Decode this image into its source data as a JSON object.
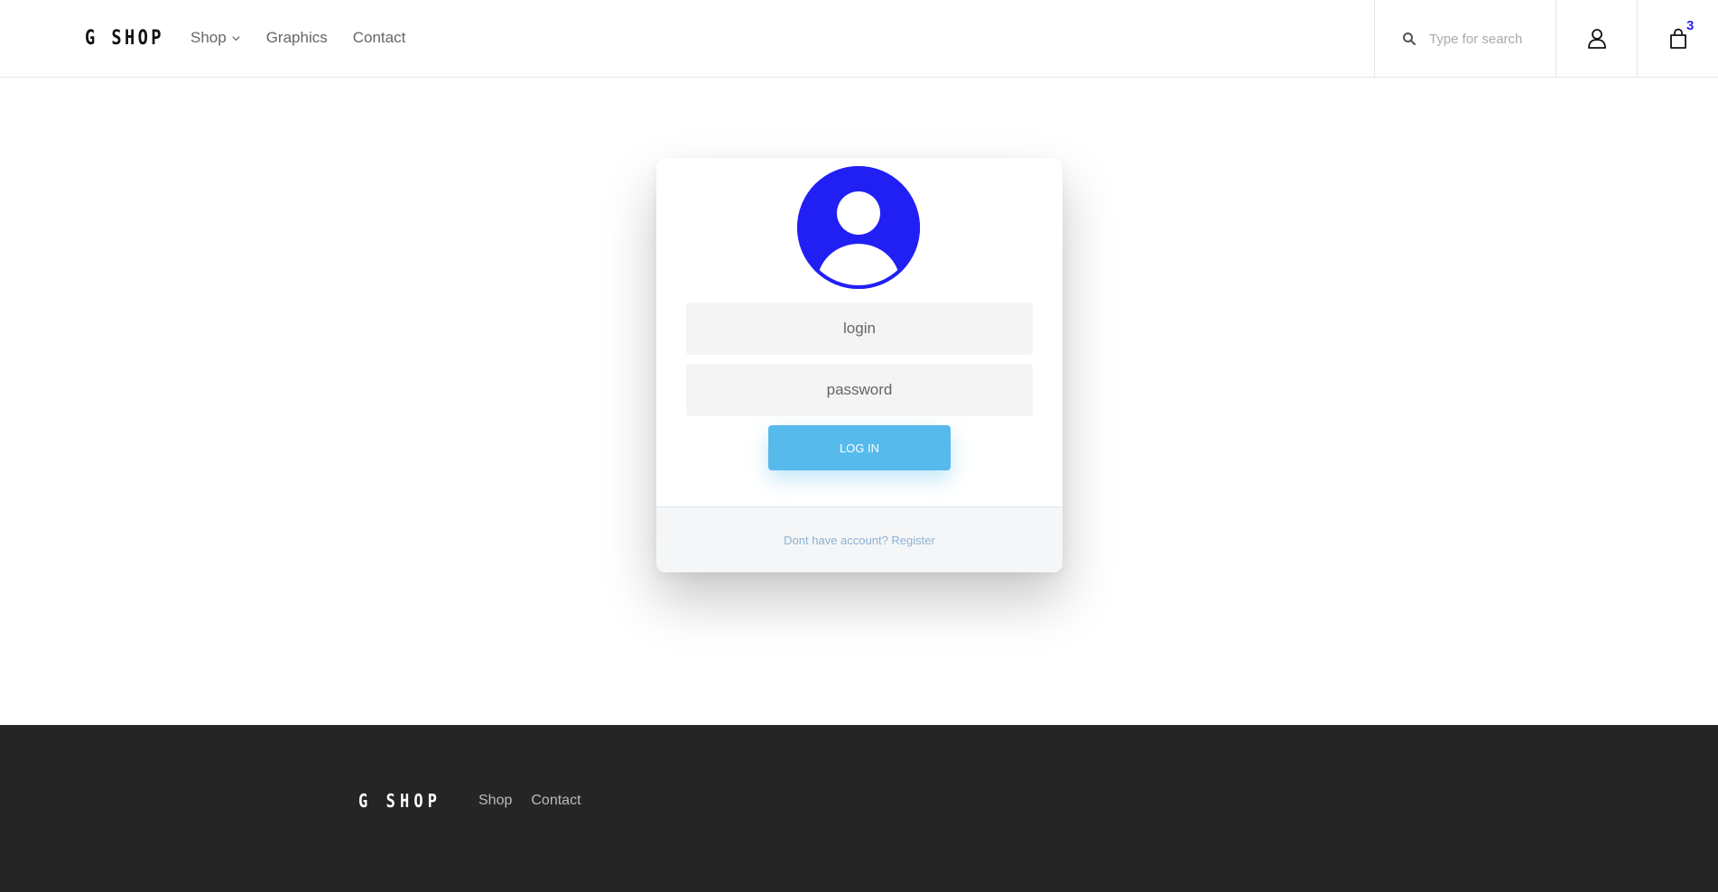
{
  "header": {
    "logo": "G SHOP",
    "nav": [
      {
        "label": "Shop",
        "has_dropdown": true
      },
      {
        "label": "Graphics"
      },
      {
        "label": "Contact"
      }
    ],
    "search_placeholder": "Type for search",
    "cart_count": "3"
  },
  "login": {
    "avatar_icon": "user-avatar-icon",
    "login_placeholder": "login",
    "password_placeholder": "password",
    "submit_label": "LOG IN",
    "register_link": "Dont have account? Register"
  },
  "footer": {
    "logo": "G SHOP",
    "links": [
      "Shop",
      "Contact"
    ]
  },
  "colors": {
    "accent": "#56baec",
    "avatar": "#2020f5",
    "cart_badge": "#2a22f5",
    "footer_bg": "#252525",
    "register_link": "#8ab3d6"
  },
  "icons": [
    "search-icon",
    "user-icon",
    "shopping-bag-icon",
    "chevron-down-icon"
  ]
}
